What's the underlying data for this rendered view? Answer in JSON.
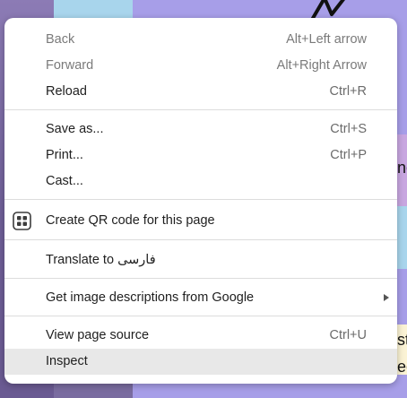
{
  "menu": {
    "items": [
      {
        "label": "Back",
        "shortcut": "Alt+Left arrow",
        "disabled": true
      },
      {
        "label": "Forward",
        "shortcut": "Alt+Right Arrow",
        "disabled": true
      },
      {
        "label": "Reload",
        "shortcut": "Ctrl+R"
      },
      {
        "label": "Save as...",
        "shortcut": "Ctrl+S"
      },
      {
        "label": "Print...",
        "shortcut": "Ctrl+P"
      },
      {
        "label": "Cast..."
      },
      {
        "label": "Create QR code for this page",
        "icon": "qr-code-icon"
      },
      {
        "label": "Translate to فارسی"
      },
      {
        "label": "Get image descriptions from Google",
        "submenu": true,
        "icon": "chevron-right-icon"
      },
      {
        "label": "View page source",
        "shortcut": "Ctrl+U"
      },
      {
        "label": "Inspect",
        "highlighted": true
      }
    ]
  },
  "background": {
    "glyphs": [
      "ne",
      "st",
      "ec"
    ]
  }
}
